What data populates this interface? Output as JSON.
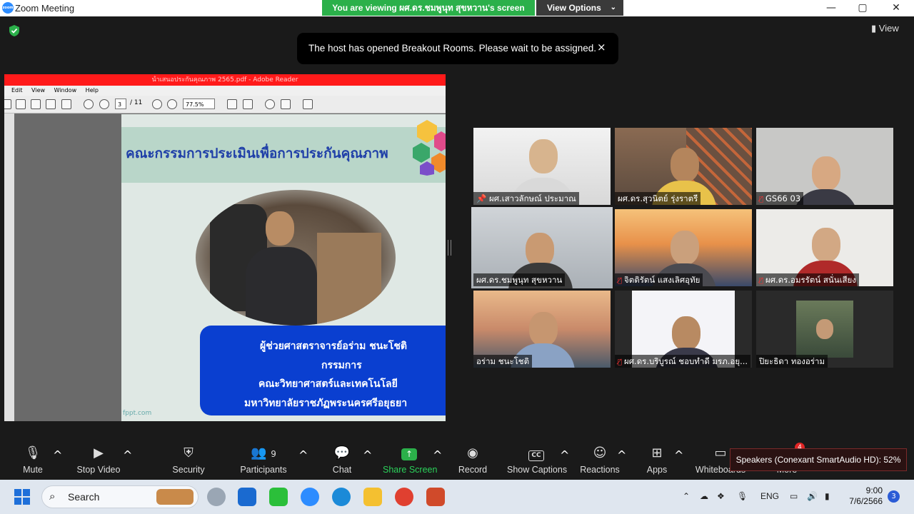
{
  "window": {
    "title": "Zoom Meeting",
    "app_logo_text": "zoom",
    "controls": {
      "minimize": "—",
      "maximize": "▢",
      "close": "✕"
    }
  },
  "share_banner": {
    "text": "You are viewing ผศ.ดร.ชมพูนุท  สุขหวาน's screen",
    "view_options": "View Options"
  },
  "view_button": "View",
  "toast": {
    "message": "The host has opened Breakout Rooms. Please wait to be assigned.",
    "close": "×"
  },
  "shared_screen": {
    "reader_title": "นำเสนอประกันคุณภาพ 2565.pdf - Adobe Reader",
    "menu": [
      "Edit",
      "View",
      "Window",
      "Help"
    ],
    "page_current": "3",
    "page_total": "/ 11",
    "zoom": "77.5%",
    "slide": {
      "heading": "คณะกรรมการประเมินเพื่อการประกันคุณภาพ",
      "lines": [
        "ผู้ช่วยศาสตราจารย์อร่าม   ชนะโชติ",
        "กรรมการ",
        "คณะวิทยาศาสตร์และเทคโนโลยี",
        "มหาวิทยาลัยราชภัฏพระนครศรีอยุธยา"
      ],
      "footer": "fppt.com"
    }
  },
  "participants": [
    {
      "name": "ผศ.เสาวลักษณ์ ประมาณ",
      "muted": false,
      "pinned": true
    },
    {
      "name": "ผศ.ดร.สุวนิตย์ รุ่งราตรี",
      "muted": false
    },
    {
      "name": "GS66 03",
      "muted": true
    },
    {
      "name": "ผศ.ดร.ชมพูนุท  สุขหวาน",
      "muted": false,
      "active": true
    },
    {
      "name": "จิตติรัตน์ แสงเลิศอุทัย",
      "muted": true
    },
    {
      "name": "ผศ.ดร.อมรรัตน์  สนั่นเสียง",
      "muted": true
    },
    {
      "name": "อร่าม ชนะโชติ",
      "muted": false
    },
    {
      "name": "ผศ.ดร.บริบูรณ์ ชอบทำดี มรภ.อยุ...",
      "muted": true
    },
    {
      "name": "ปิยะธิดา ทองอร่าม",
      "muted": false
    }
  ],
  "toolbar": {
    "mute": "Mute",
    "stop_video": "Stop Video",
    "security": "Security",
    "participants": "Participants",
    "participants_count": "9",
    "chat": "Chat",
    "share_screen": "Share Screen",
    "record": "Record",
    "show_captions": "Show Captions",
    "captions_icon_text": "CC",
    "reactions": "Reactions",
    "apps": "Apps",
    "whiteboards": "Whiteboards",
    "more": "More",
    "more_badge": "4"
  },
  "speakers_tooltip": "Speakers (Conexant SmartAudio HD): 52%",
  "taskbar": {
    "search": "Search",
    "language": "ENG",
    "time": "9:00",
    "date": "7/6/2566",
    "notifications": "3"
  },
  "colors": {
    "zoom_blue": "#2d8cff",
    "share_green": "#2bb04a",
    "active_speaker": "#ecec5a",
    "muted_red": "#e33333"
  }
}
